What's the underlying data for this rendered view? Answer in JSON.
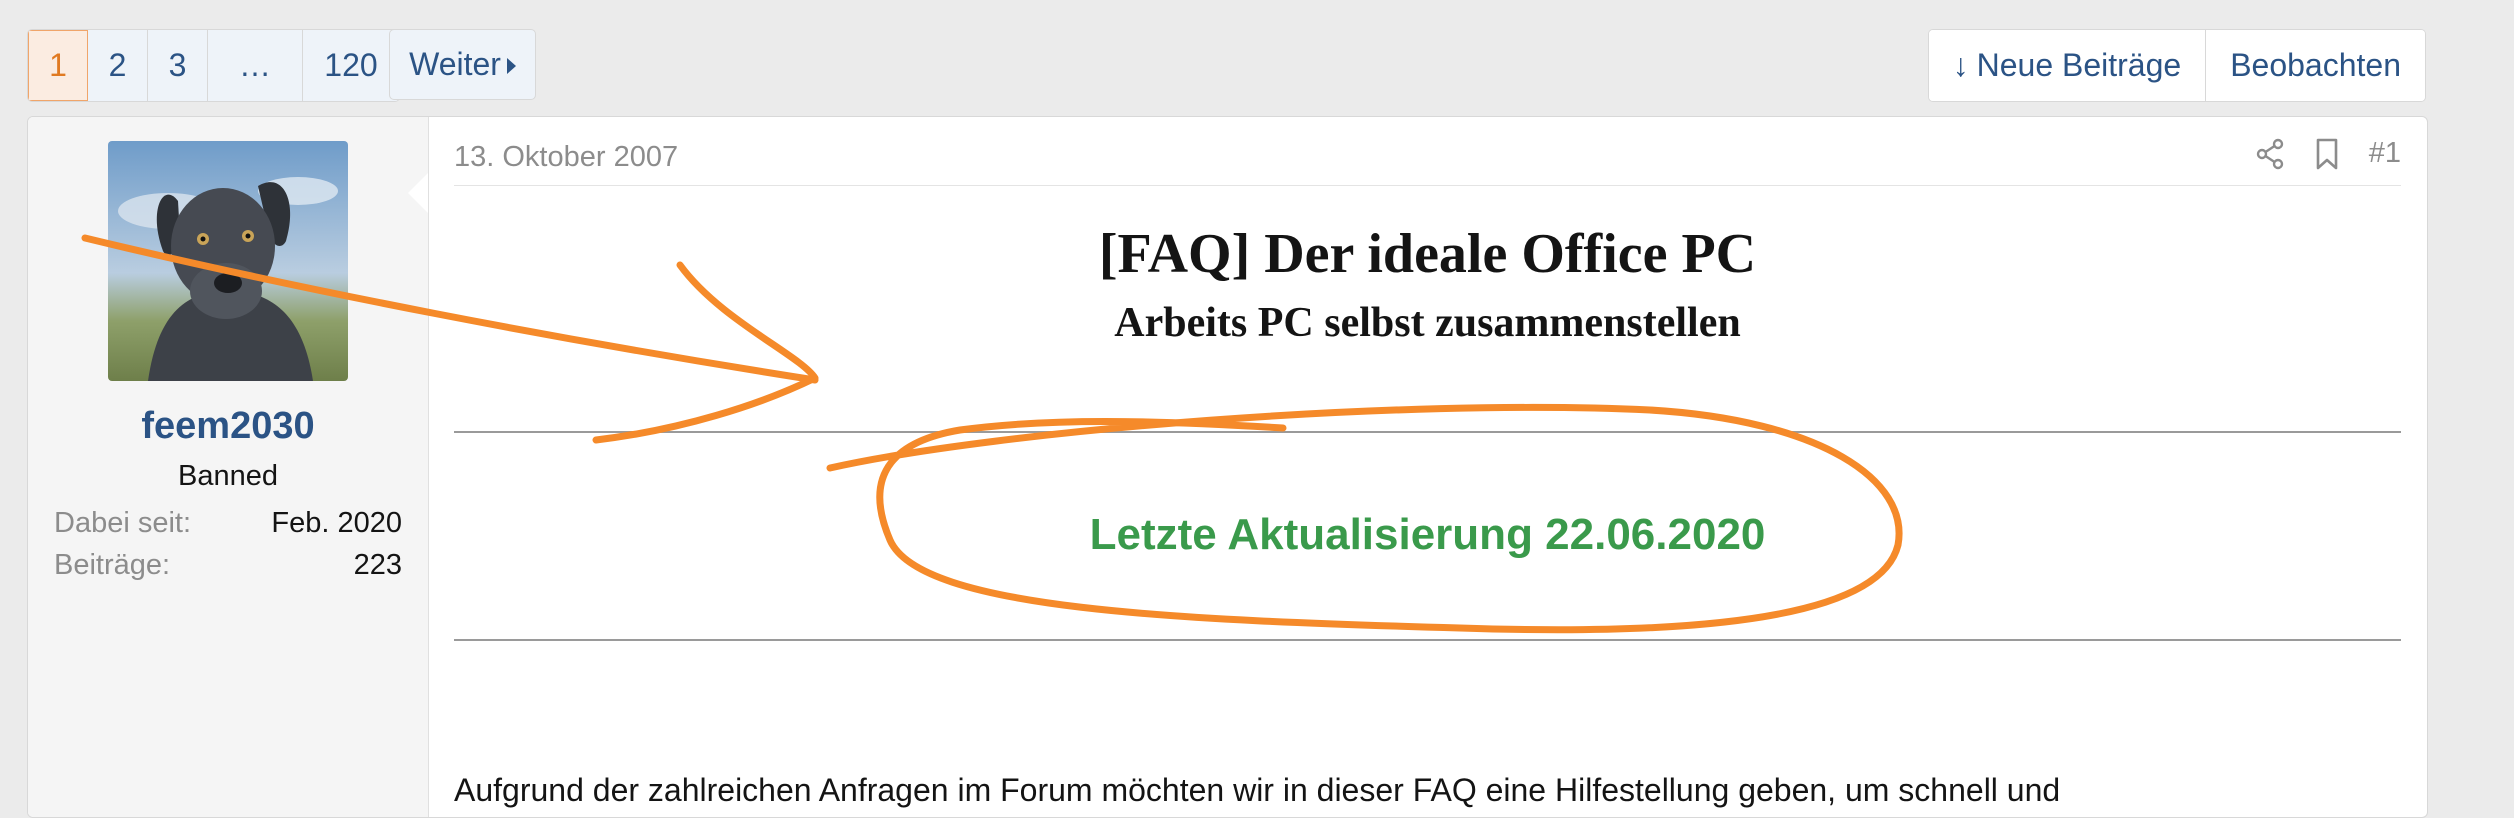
{
  "pagination": {
    "pages": [
      "1",
      "2",
      "3",
      "…",
      "120"
    ],
    "current": "1",
    "next_label": "Weiter"
  },
  "actions": {
    "new_posts_arrow": "↓",
    "new_posts_label": "Neue Beiträge",
    "watch_label": "Beobachten"
  },
  "user": {
    "name": "feem2030",
    "title": "Banned",
    "stats": [
      {
        "key": "Dabei seit:",
        "value": "Feb. 2020"
      },
      {
        "key": "Beiträge:",
        "value": "223"
      }
    ]
  },
  "post": {
    "date": "13. Oktober 2007",
    "number": "#1",
    "title": "[FAQ] Der ideale Office PC",
    "subtitle": "Arbeits PC selbst zusammenstellen",
    "update_text": "Letzte Aktualisierung 22.06.2020",
    "body_start": "Aufgrund der zahlreichen Anfragen im Forum möchten wir in dieser FAQ eine Hilfestellung geben, um schnell und"
  },
  "colors": {
    "link": "#2b5385",
    "accent": "#e07a22",
    "annotation": "#f58a2a",
    "update_green": "#3a9a4b"
  },
  "icons": {
    "share": "share-icon",
    "bookmark": "bookmark-icon",
    "next": "caret-right-icon"
  }
}
